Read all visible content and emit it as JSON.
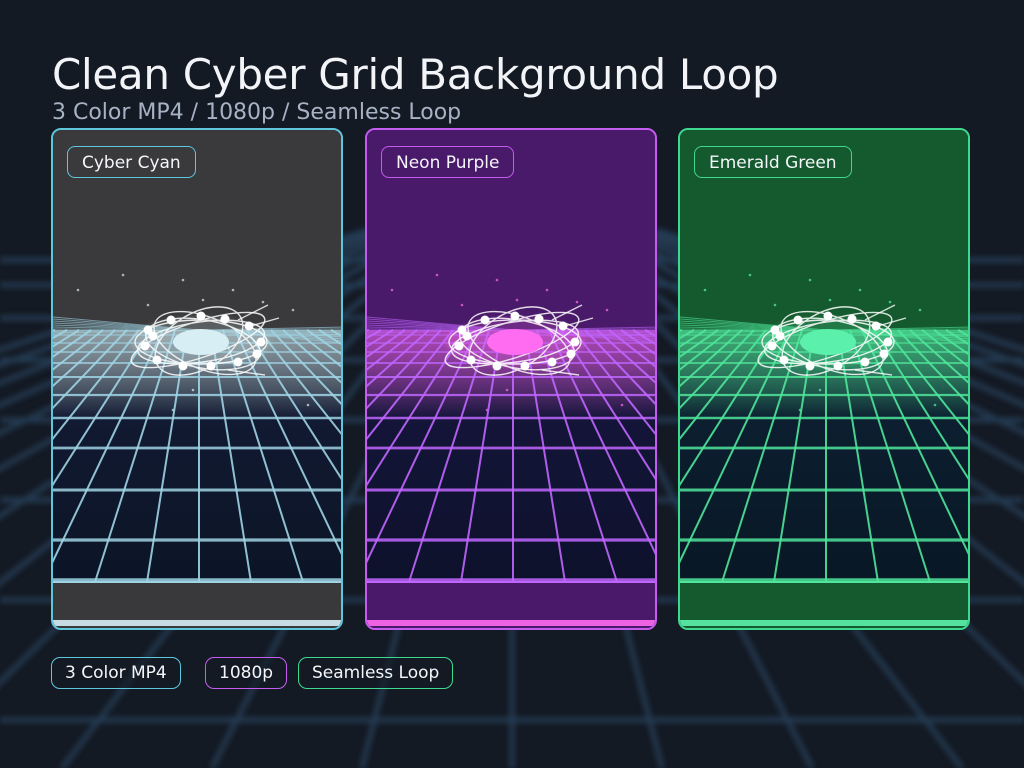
{
  "header": {
    "title": "Clean Cyber Grid Background Loop",
    "subtitle": "3 Color MP4  /  1080p  /  Seamless Loop"
  },
  "panels": [
    {
      "label": "Cyber Cyan",
      "accent": "#5fc7dc",
      "bg": "#3a3a3c",
      "grid": "#9fd4e4",
      "glow": "#d6eef4"
    },
    {
      "label": "Neon Purple",
      "accent": "#c45cf0",
      "bg": "#4a1a6a",
      "grid": "#c066ff",
      "glow": "#ff6cf2"
    },
    {
      "label": "Emerald Green",
      "accent": "#3ed88f",
      "bg": "#155a2e",
      "grid": "#4fe59a",
      "glow": "#5cf0ad"
    }
  ],
  "chips": [
    {
      "label": "3 Color MP4",
      "accent": "#5fc7dc"
    },
    {
      "label": "1080p",
      "accent": "#c45cf0"
    },
    {
      "label": "Seamless Loop",
      "accent": "#3ed88f"
    }
  ]
}
